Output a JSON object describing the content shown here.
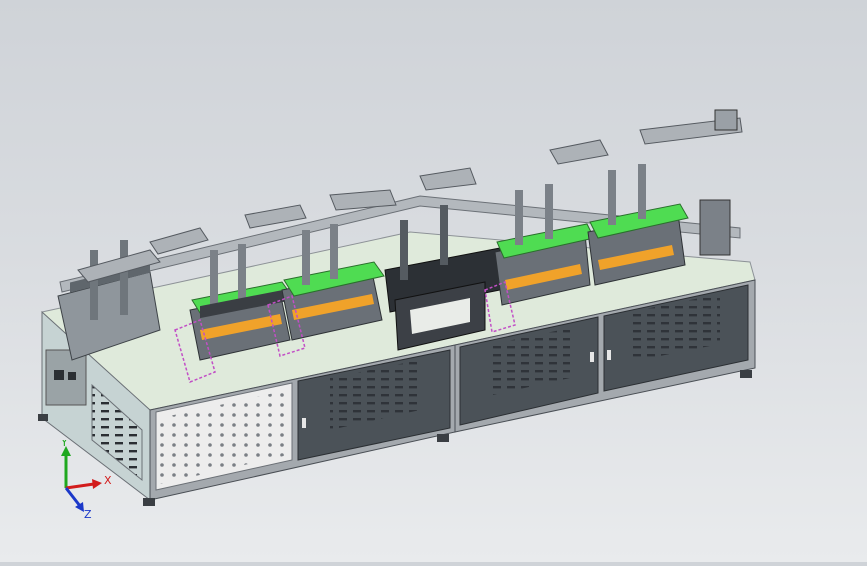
{
  "axes": {
    "x": "X",
    "y": "Y",
    "z": "Z"
  },
  "colors": {
    "background_top": "#cfd3d8",
    "base_top": "#dfeadb",
    "frame": "#9ea3a8",
    "cabinet_door": "#4b5258",
    "side_panel": "#c6d3d3",
    "press_plate": "#4fdc52",
    "press_frame": "#5a5f66",
    "orange_parts": "#f0a22a",
    "magenta_wire": "#c24fc6",
    "axis_x": "#d21c1c",
    "axis_y": "#1fa81f",
    "axis_z": "#1b38c9"
  }
}
